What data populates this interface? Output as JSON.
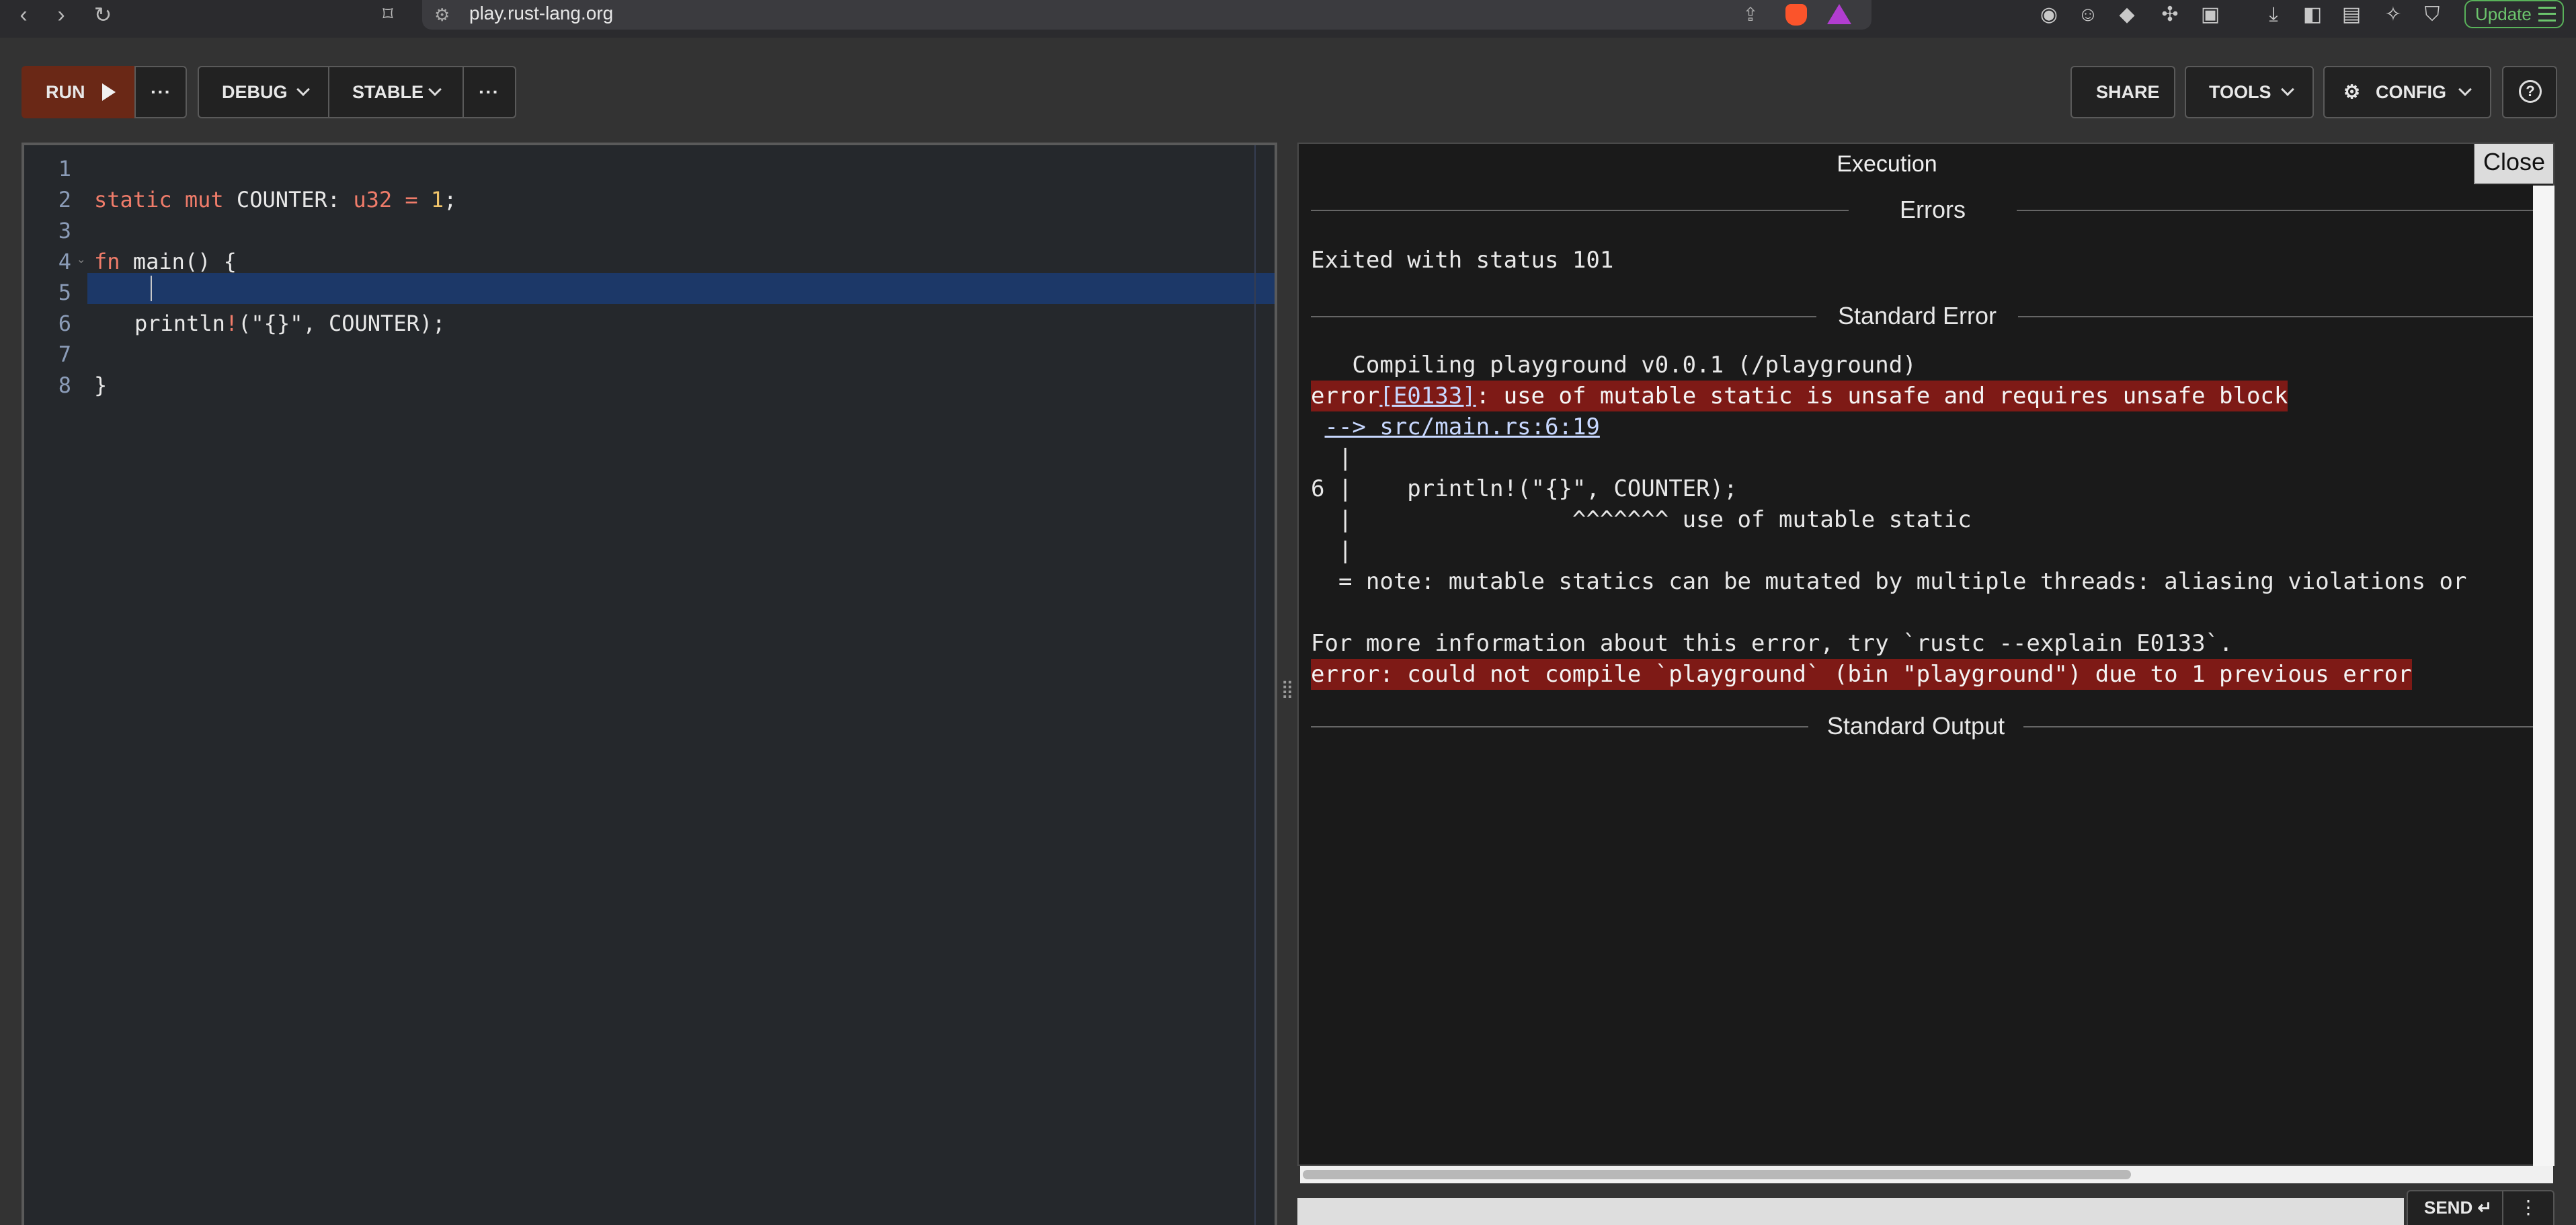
{
  "browser": {
    "url": "play.rust-lang.org",
    "update_label": "Update"
  },
  "toolbar": {
    "run_label": "RUN",
    "run_more": "···",
    "debug_label": "DEBUG",
    "stable_label": "STABLE",
    "more_label": "···",
    "share_label": "SHARE",
    "tools_label": "TOOLS",
    "config_label": "CONFIG"
  },
  "editor": {
    "line_numbers": [
      "1",
      "2",
      "3",
      "4",
      "5",
      "6",
      "7",
      "8"
    ],
    "current_line": "5",
    "code": {
      "l2_static": "static",
      "l2_mut": "mut",
      "l2_name": "COUNTER:",
      "l2_type": "u32",
      "l2_eq": "=",
      "l2_val": "1",
      "l2_semi": ";",
      "l4_fn": "fn",
      "l4_rest": "main() {",
      "l6_macro": "println",
      "l6_bang": "!",
      "l6_rest": "(\"{}\", COUNTER);",
      "l8": "}"
    }
  },
  "output": {
    "title": "Execution",
    "close_label": "Close",
    "sections": {
      "errors": "Errors",
      "stderr": "Standard Error",
      "stdout": "Standard Output"
    },
    "exit_status": "Exited with status 101",
    "stderr_lines": {
      "compiling": "   Compiling playground v0.0.1 (/playground)",
      "error_prefix": "error",
      "error_code": "[E0133]",
      "error_msg": ": use of mutable static is unsafe and requires unsafe block",
      "arrow_pad": " ",
      "arrow_link": "--> src/main.rs:6:19",
      "pipe1": "  |",
      "code_line": "6 |    println!(\"{}\", COUNTER);",
      "caret_line": "  |                ^^^^^^^ use of mutable static",
      "pipe2": "  |",
      "note": "  = note: mutable statics can be mutated by multiple threads: aliasing violations or",
      "more_info": "For more information about this error, try `rustc --explain E0133`.",
      "final_error": "error: could not compile `playground` (bin \"playground\") due to 1 previous error"
    },
    "send_label": "SEND ↵",
    "send_more": "⋮"
  }
}
